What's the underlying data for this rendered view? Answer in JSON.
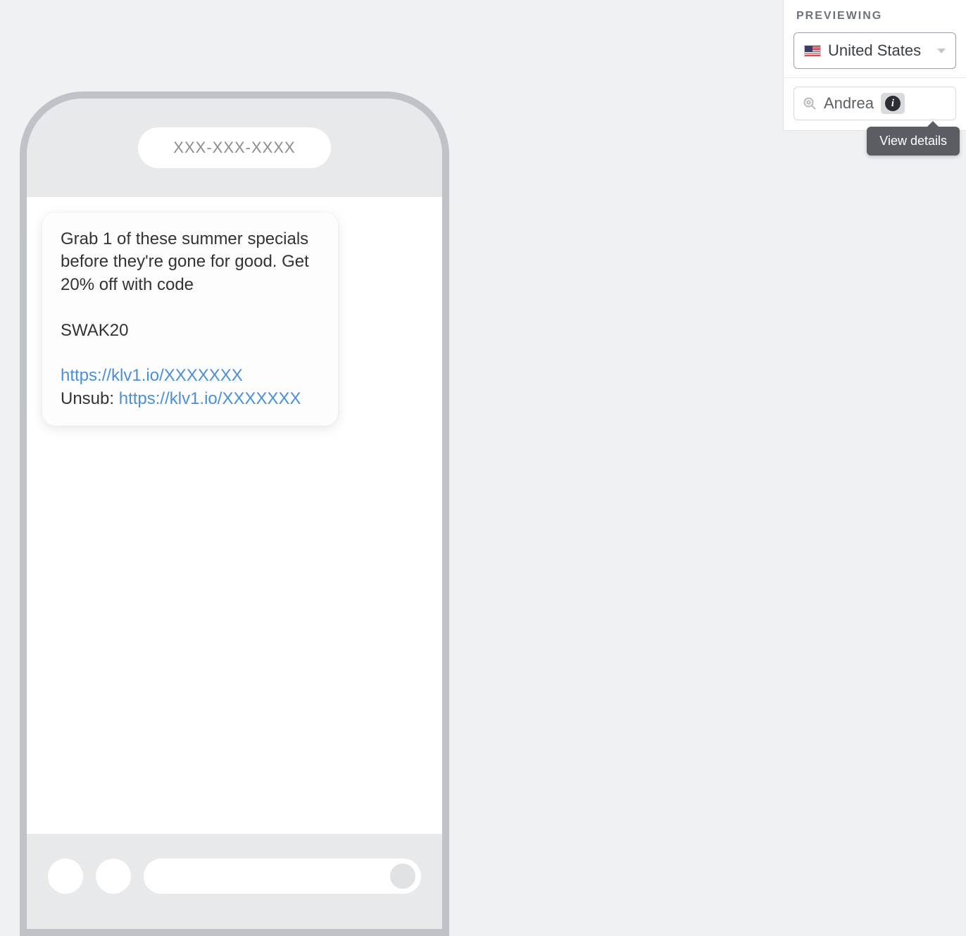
{
  "phone": {
    "number_placeholder": "XXX-XXX-XXXX",
    "message": {
      "part1": "Grab 1 of these summer specials before they're gone for good. Get 20% off with code",
      "code": "SWAK20",
      "link1": "https://klv1.io/XXXXXXX",
      "unsub_label": "Unsub: ",
      "unsub_link": "https://klv1.io/XXXXXXX"
    }
  },
  "panel": {
    "title": "PREVIEWING",
    "country": "United States",
    "profile_name": "Andrea",
    "tooltip": "View details"
  }
}
